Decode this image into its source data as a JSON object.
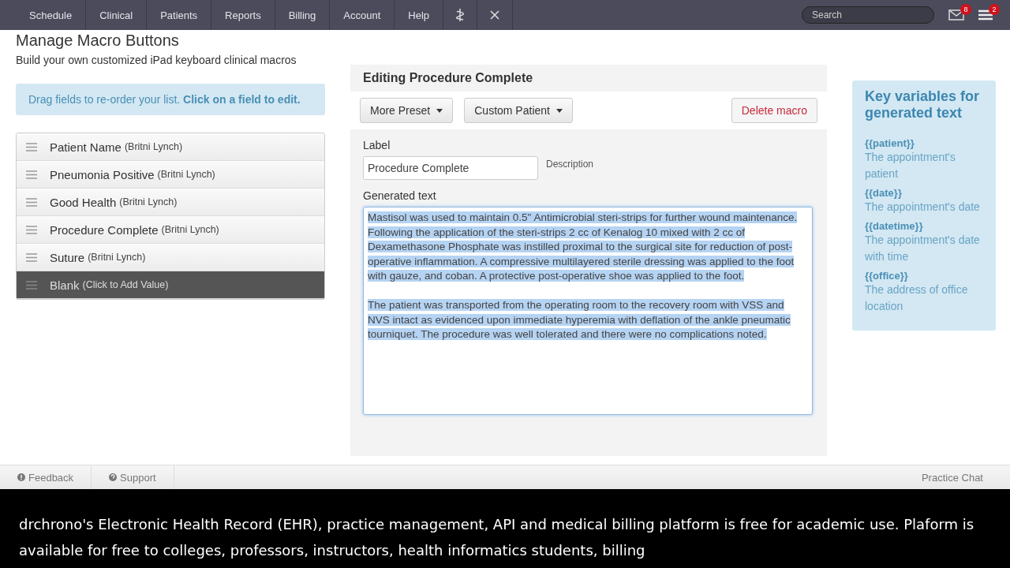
{
  "nav": {
    "items": [
      {
        "label": "Schedule",
        "kind": "text"
      },
      {
        "label": "Clinical",
        "kind": "text"
      },
      {
        "label": "Patients",
        "kind": "text"
      },
      {
        "label": "Reports",
        "kind": "text"
      },
      {
        "label": "Billing",
        "kind": "text"
      },
      {
        "label": "Account",
        "kind": "text"
      },
      {
        "label": "Help",
        "kind": "text"
      },
      {
        "kind": "caduceus"
      },
      {
        "kind": "close"
      }
    ],
    "search": {
      "placeholder": "Search"
    },
    "mail_badge": "8",
    "menu_badge": "2"
  },
  "page": {
    "title": "Manage Macro Buttons",
    "subtitle": "Build your own customized iPad keyboard clinical macros"
  },
  "hint": "Drag fields to re-order your list. **Click on a field to edit.**",
  "macros": [
    {
      "name": "Patient Name",
      "owner": "(Britni Lynch)",
      "selected": false
    },
    {
      "name": "Pneumonia Positive",
      "owner": "(Britni Lynch)",
      "selected": false
    },
    {
      "name": "Good Health",
      "owner": "(Britni Lynch)",
      "selected": false
    },
    {
      "name": "Procedure Complete",
      "owner": "(Britni Lynch)",
      "selected": false
    },
    {
      "name": "Suture",
      "owner": "(Britni Lynch)",
      "selected": false
    },
    {
      "name": "Blank",
      "owner": "(Click to Add Value)",
      "selected": true
    }
  ],
  "editor": {
    "title": "Editing Procedure Complete",
    "buttons": [
      {
        "label": "More Preset",
        "kind": "dropdown"
      },
      {
        "label": "Custom Patient",
        "kind": "dropdown"
      },
      {
        "label": "Delete macro",
        "kind": "danger"
      }
    ],
    "label_caption": "Label",
    "label_value": "Procedure Complete",
    "description_caption": "Description",
    "generated_caption": "Generated text",
    "text_selected": true,
    "paragraphs": [
      "Mastisol was used to maintain 0.5\" Antimicrobial steri-strips for further wound maintenance. Following the application of the steri-strips 2 cc of Kenalog 10 mixed with 2 cc of Dexamethasone Phosphate was instilled proximal to the surgical site for reduction of post-operative inflammation. A compressive multilayered sterile dressing was applied to the foot with gauze, and coban. A protective post-operative shoe was applied to the foot.",
      "The patient was transported from the operating room to the recovery room with VSS and NVS intact as evidenced upon immediate hyperemia with deflation of the ankle pneumatic tourniquet. The procedure was well tolerated and there were no complications noted."
    ]
  },
  "variables": {
    "title": "Key variables for generated text",
    "items": [
      {
        "key": "{{patient}}",
        "desc": "The appointment's patient"
      },
      {
        "key": "{{date}}",
        "desc": "The appointment's date"
      },
      {
        "key": "{{datetime}}",
        "desc": "The appointment's date with time"
      },
      {
        "key": "{{office}}",
        "desc": "The address of office location"
      }
    ]
  },
  "footer": {
    "feedback": "Feedback",
    "support": "Support",
    "chat": "Practice Chat"
  },
  "caption": "drchrono's Electronic Health Record (EHR), practice management, API and medical billing platform is free for academic use. Plaform is available for free to colleges, professors, instructors, health informatics students, billing"
}
